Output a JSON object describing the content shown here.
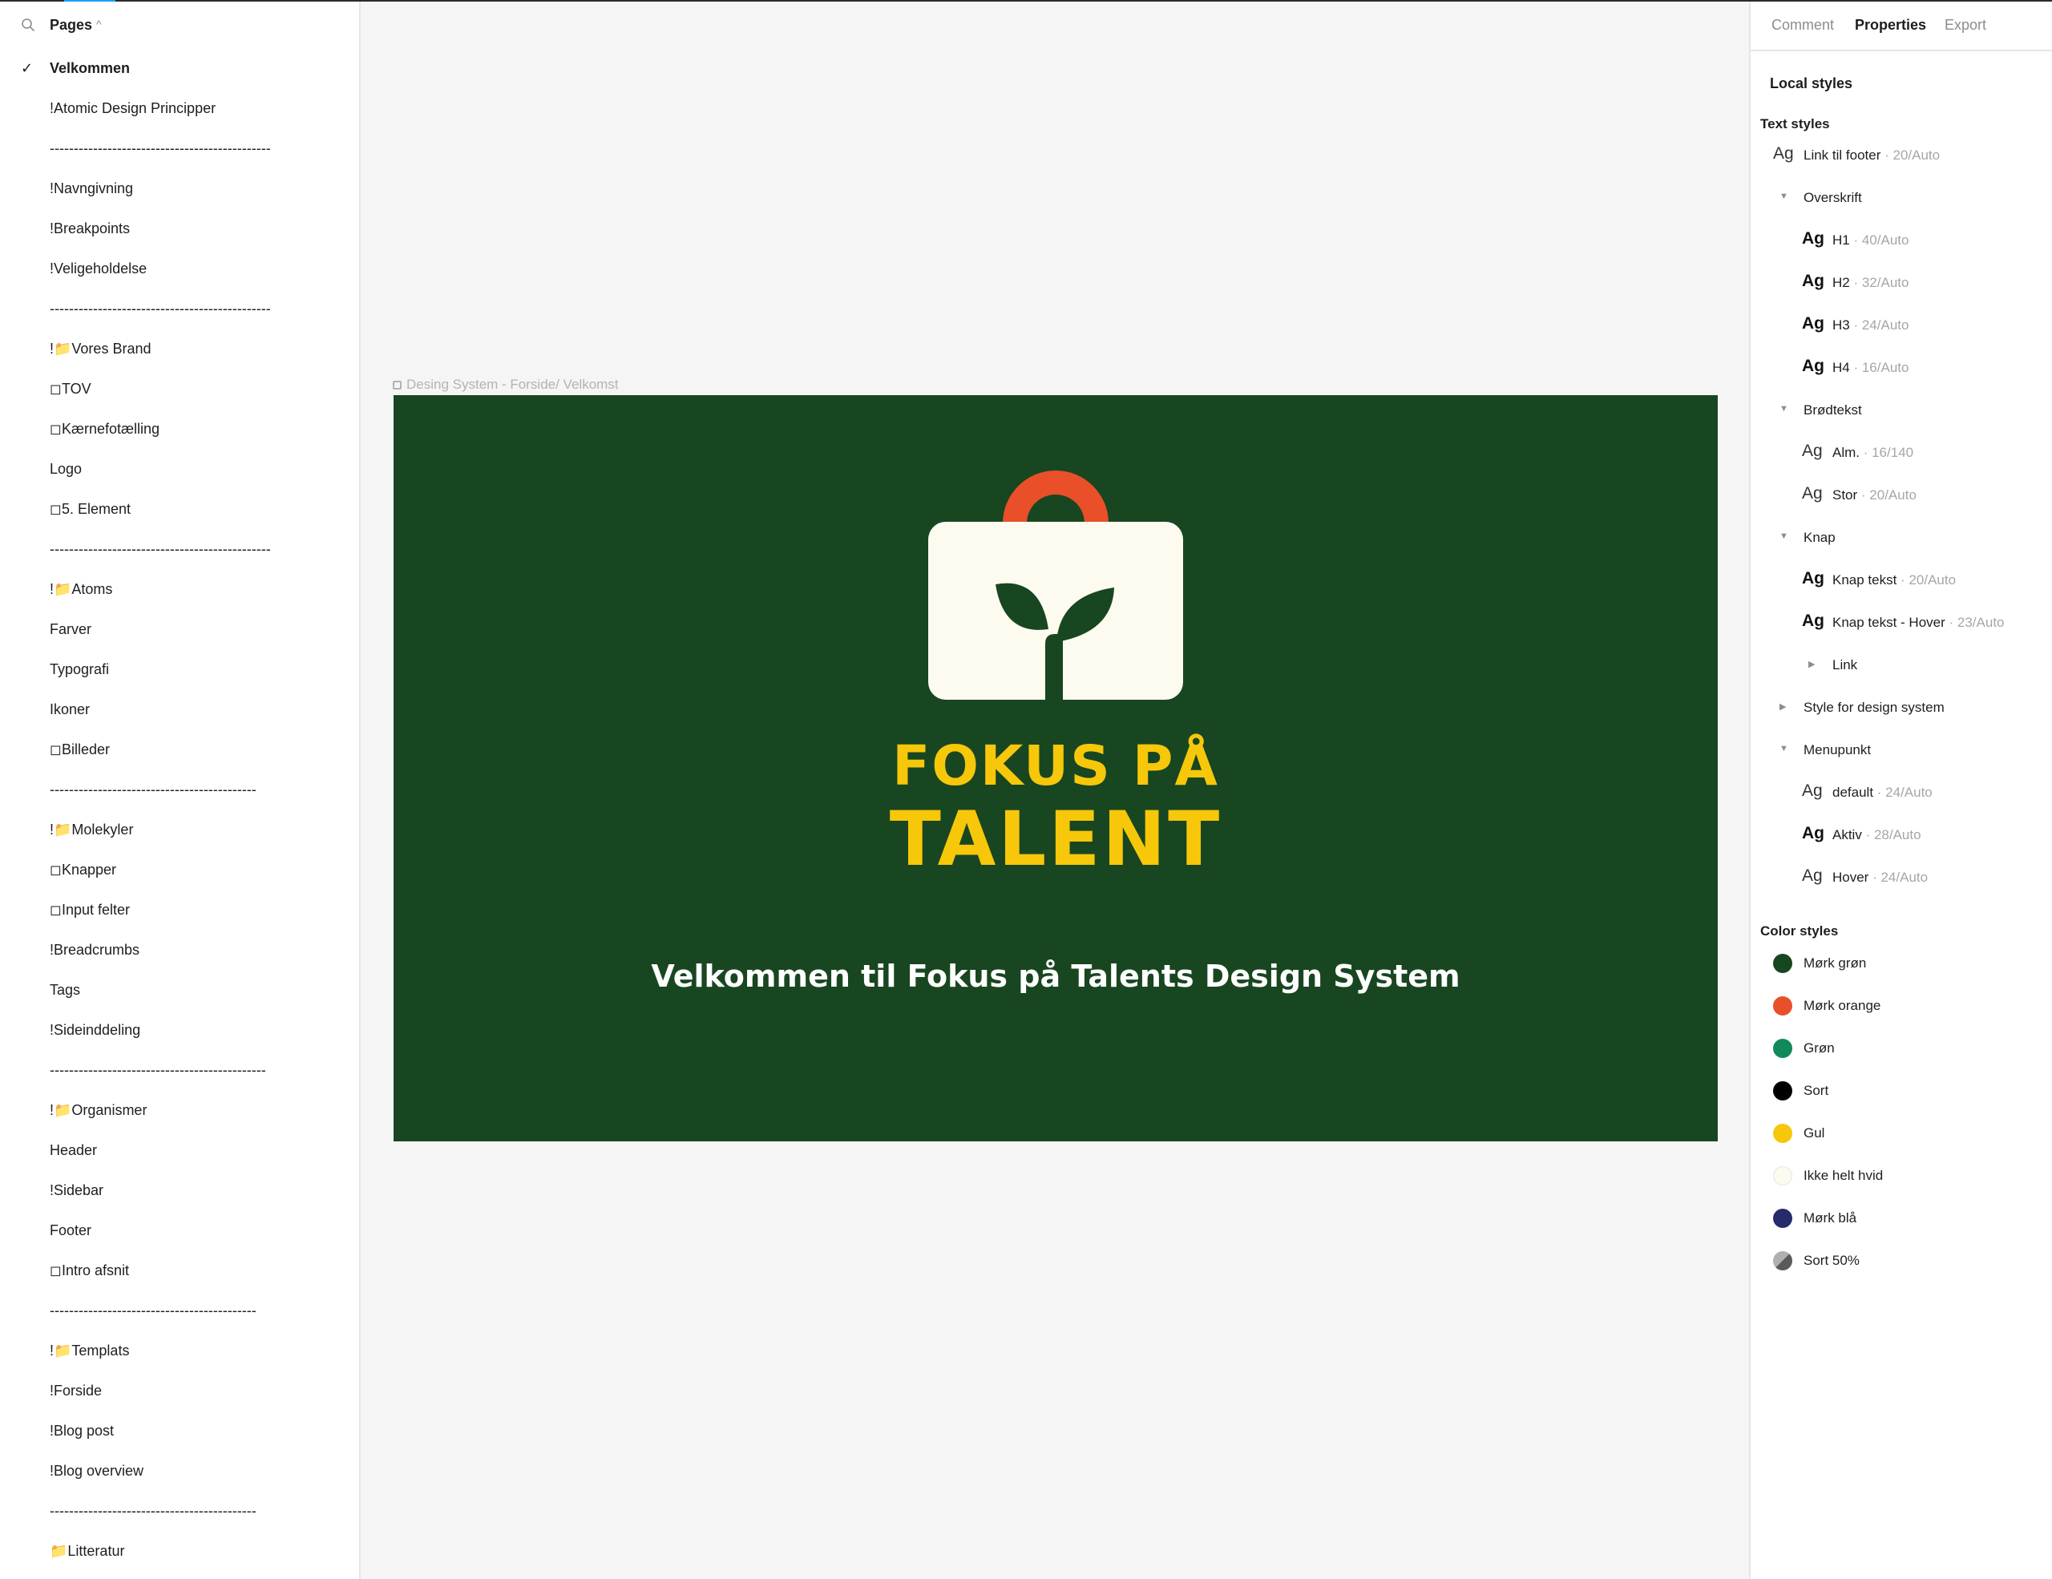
{
  "left_panel": {
    "title": "Pages",
    "pages": [
      {
        "label": "Velkommen",
        "active": true
      },
      {
        "label": "!Atomic Design Principper"
      },
      {
        "label": "----------------------------------------------"
      },
      {
        "label": "!Navngivning"
      },
      {
        "label": "!Breakpoints"
      },
      {
        "label": "!Veligeholdelse"
      },
      {
        "label": "----------------------------------------------"
      },
      {
        "label": "!📁Vores Brand"
      },
      {
        "label": "◻TOV"
      },
      {
        "label": "◻Kærnefotælling"
      },
      {
        "label": "Logo"
      },
      {
        "label": "◻5. Element"
      },
      {
        "label": "----------------------------------------------"
      },
      {
        "label": "!📁Atoms"
      },
      {
        "label": "Farver"
      },
      {
        "label": "Typografi"
      },
      {
        "label": "Ikoner"
      },
      {
        "label": "◻Billeder"
      },
      {
        "label": "-------------------------------------------"
      },
      {
        "label": "!📁Molekyler"
      },
      {
        "label": "◻Knapper"
      },
      {
        "label": "◻Input felter"
      },
      {
        "label": "!Breadcrumbs"
      },
      {
        "label": "Tags"
      },
      {
        "label": "!Sideinddeling"
      },
      {
        "label": "---------------------------------------------"
      },
      {
        "label": "!📁Organismer"
      },
      {
        "label": "Header"
      },
      {
        "label": "!Sidebar"
      },
      {
        "label": "Footer"
      },
      {
        "label": "◻Intro afsnit"
      },
      {
        "label": "-------------------------------------------"
      },
      {
        "label": "!📁Templats"
      },
      {
        "label": "!Forside"
      },
      {
        "label": "!Blog post"
      },
      {
        "label": "!Blog overview"
      },
      {
        "label": "-------------------------------------------"
      },
      {
        "label": "📁Litteratur"
      }
    ]
  },
  "canvas": {
    "frame_label": "Desing System - Forside/ Velkomst",
    "frame": {
      "brand_line1": "FOKUS PÅ",
      "brand_line2": "TALENT",
      "welcome_text": "Velkommen til Fokus på Talents Design System",
      "bg_color": "#184620",
      "brand_color": "#f7c70a",
      "bag_color": "#fdfbef",
      "handle_color": "#e9502a"
    }
  },
  "right_panel": {
    "tabs": [
      {
        "label": "Comment",
        "active": false
      },
      {
        "label": "Properties",
        "active": true
      },
      {
        "label": "Export",
        "active": false
      }
    ],
    "local_styles_label": "Local styles",
    "text_styles_title": "Text styles",
    "text_styles": [
      {
        "type": "style",
        "ag": "Ag",
        "bold": false,
        "indent": 0,
        "name": "Link til footer",
        "meta": " · 20/Auto"
      },
      {
        "type": "group",
        "caret": "▼",
        "indent": 0,
        "name": "Overskrift"
      },
      {
        "type": "style",
        "ag": "Ag",
        "bold": true,
        "indent": 1,
        "name": "H1",
        "meta": " · 40/Auto"
      },
      {
        "type": "style",
        "ag": "Ag",
        "bold": true,
        "indent": 1,
        "name": "H2",
        "meta": " · 32/Auto"
      },
      {
        "type": "style",
        "ag": "Ag",
        "bold": true,
        "indent": 1,
        "name": "H3",
        "meta": " · 24/Auto"
      },
      {
        "type": "style",
        "ag": "Ag",
        "bold": true,
        "indent": 1,
        "name": "H4",
        "meta": " · 16/Auto"
      },
      {
        "type": "group",
        "caret": "▼",
        "indent": 0,
        "name": "Brødtekst"
      },
      {
        "type": "style",
        "ag": "Ag",
        "bold": false,
        "indent": 1,
        "name": "Alm.",
        "meta": " · 16/140"
      },
      {
        "type": "style",
        "ag": "Ag",
        "bold": false,
        "indent": 1,
        "name": "Stor",
        "meta": " · 20/Auto"
      },
      {
        "type": "group",
        "caret": "▼",
        "indent": 0,
        "name": "Knap"
      },
      {
        "type": "style",
        "ag": "Ag",
        "bold": true,
        "indent": 1,
        "name": "Knap tekst",
        "meta": " · 20/Auto"
      },
      {
        "type": "style",
        "ag": "Ag",
        "bold": true,
        "indent": 1,
        "name": "Knap tekst - Hover",
        "meta": " · 23/Auto"
      },
      {
        "type": "group",
        "caret": "▶",
        "indent": 1,
        "name": "Link"
      },
      {
        "type": "group",
        "caret": "▶",
        "indent": 0,
        "name": "Style for design system"
      },
      {
        "type": "group",
        "caret": "▼",
        "indent": 0,
        "name": "Menupunkt"
      },
      {
        "type": "style",
        "ag": "Ag",
        "bold": false,
        "indent": 1,
        "name": "default",
        "meta": " · 24/Auto"
      },
      {
        "type": "style",
        "ag": "Ag",
        "bold": true,
        "indent": 1,
        "name": "Aktiv",
        "meta": " · 28/Auto"
      },
      {
        "type": "style",
        "ag": "Ag",
        "bold": false,
        "indent": 1,
        "name": "Hover",
        "meta": " · 24/Auto"
      }
    ],
    "color_styles_title": "Color styles",
    "color_styles": [
      {
        "name": "Mørk grøn",
        "color": "#184620"
      },
      {
        "name": "Mørk orange",
        "color": "#e9502a"
      },
      {
        "name": "Grøn",
        "color": "#12895a"
      },
      {
        "name": "Sort",
        "color": "#000000"
      },
      {
        "name": "Gul",
        "color": "#f7c70a"
      },
      {
        "name": "Ikke helt hvid",
        "color": "#fdfbef"
      },
      {
        "name": "Mørk blå",
        "color": "#252b6b"
      },
      {
        "name": "Sort 50%",
        "color": "#808080"
      }
    ]
  }
}
